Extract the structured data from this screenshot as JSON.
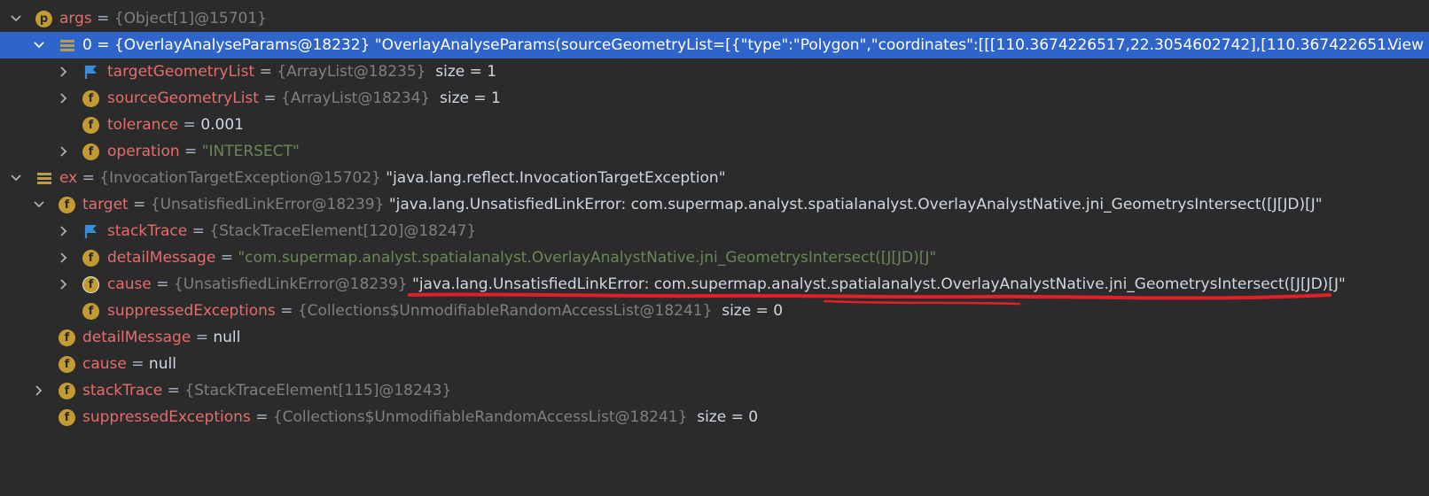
{
  "colors": {
    "background": "#2b2b2b",
    "selection": "#2f65ca",
    "name": "#e46d6d",
    "type": "#808080",
    "string": "#6a8759",
    "icon": "#c49a32",
    "flag": "#3a8bd9",
    "underline": "#e0202a"
  },
  "rows": [
    {
      "name": "args",
      "eq": "=",
      "type": "{Object[1]@15701}",
      "icon": "p-icon"
    },
    {
      "name": "0",
      "eq": "=",
      "type": "{OverlayAnalyseParams@18232}",
      "value": "\"OverlayAnalyseParams(sourceGeometryList=[{\"type\":\"Polygon\",\"coordinates\":[[[110.3674226517,22.3054602742],[110.367422651...",
      "link": "View",
      "icon": "array-element-icon"
    },
    {
      "name": "targetGeometryList",
      "eq": "=",
      "type": "{ArrayList@18235}",
      "extra": "size = 1",
      "icon": "flag-icon"
    },
    {
      "name": "sourceGeometryList",
      "eq": "=",
      "type": "{ArrayList@18234}",
      "extra": "size = 1",
      "icon": "field-icon"
    },
    {
      "name": "tolerance",
      "eq": "=",
      "value": "0.001",
      "icon": "field-icon"
    },
    {
      "name": "operation",
      "eq": "=",
      "value": "\"INTERSECT\"",
      "icon": "field-icon"
    },
    {
      "name": "ex",
      "eq": "=",
      "type": "{InvocationTargetException@15702}",
      "value": "\"java.lang.reflect.InvocationTargetException\"",
      "icon": "array-element-icon"
    },
    {
      "name": "target",
      "eq": "=",
      "type": "{UnsatisfiedLinkError@18239}",
      "value": "\"java.lang.UnsatisfiedLinkError: com.supermap.analyst.spatialanalyst.OverlayAnalystNative.jni_GeometrysIntersect([J[JD)[J\"",
      "icon": "field-icon"
    },
    {
      "name": "stackTrace",
      "eq": "=",
      "type": "{StackTraceElement[120]@18247}",
      "icon": "flag-icon"
    },
    {
      "name": "detailMessage",
      "eq": "=",
      "value": "\"com.supermap.analyst.spatialanalyst.OverlayAnalystNative.jni_GeometrysIntersect([J[JD)[J\"",
      "icon": "field-icon"
    },
    {
      "name": "cause",
      "eq": "=",
      "type": "{UnsatisfiedLinkError@18239}",
      "value": "\"java.lang.UnsatisfiedLinkError: com.supermap.analyst.spatialanalyst.OverlayAnalystNative.jni_GeometrysIntersect([J[JD)[J\"",
      "icon": "field-icon"
    },
    {
      "name": "suppressedExceptions",
      "eq": "=",
      "type": "{Collections$UnmodifiableRandomAccessList@18241}",
      "extra": "size = 0",
      "icon": "field-icon"
    },
    {
      "name": "detailMessage",
      "eq": "=",
      "value": "null",
      "icon": "field-icon"
    },
    {
      "name": "cause",
      "eq": "=",
      "value": "null",
      "icon": "field-icon"
    },
    {
      "name": "stackTrace",
      "eq": "=",
      "type": "{StackTraceElement[115]@18243}",
      "icon": "field-icon"
    },
    {
      "name": "suppressedExceptions",
      "eq": "=",
      "type": "{Collections$UnmodifiableRandomAccessList@18241}",
      "extra": "size = 0",
      "icon": "field-icon"
    }
  ]
}
